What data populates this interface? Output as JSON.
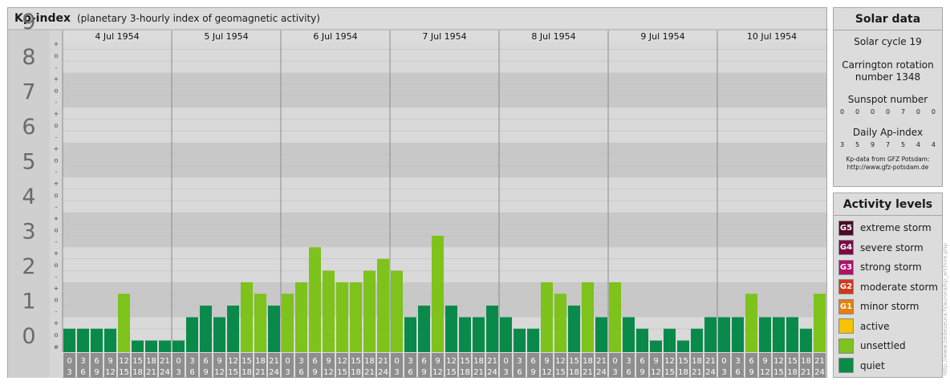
{
  "header": {
    "title": "Kp-index",
    "subtitle": "(planetary 3-hourly index of geomagnetic activity)"
  },
  "chart_data": {
    "type": "bar",
    "title": "Kp-index",
    "ylim": [
      0,
      9
    ],
    "y_ticks": [
      "0",
      "1",
      "2",
      "3",
      "4",
      "5",
      "6",
      "7",
      "8",
      "9"
    ],
    "y_minor_marks": [
      "+",
      "o",
      "-"
    ],
    "days": [
      "4 Jul 1954",
      "5 Jul 1954",
      "6 Jul 1954",
      "7 Jul 1954",
      "8 Jul 1954",
      "9 Jul 1954",
      "10 Jul 1954"
    ],
    "intervals": [
      [
        "0",
        "3"
      ],
      [
        "3",
        "6"
      ],
      [
        "6",
        "9"
      ],
      [
        "9",
        "12"
      ],
      [
        "12",
        "15"
      ],
      [
        "15",
        "18"
      ],
      [
        "18",
        "21"
      ],
      [
        "21",
        "24"
      ]
    ],
    "values": [
      0.67,
      0.67,
      0.67,
      0.67,
      1.67,
      0.33,
      0.33,
      0.33,
      0.33,
      1.0,
      1.33,
      1.0,
      1.33,
      2.0,
      1.67,
      1.33,
      1.67,
      2.0,
      3.0,
      2.33,
      2.0,
      2.0,
      2.33,
      2.67,
      2.33,
      1.0,
      1.33,
      3.33,
      1.33,
      1.0,
      1.0,
      1.33,
      1.0,
      0.67,
      0.67,
      2.0,
      1.67,
      1.33,
      2.0,
      1.0,
      2.0,
      1.0,
      0.67,
      0.33,
      0.67,
      0.33,
      0.67,
      1.0,
      1.0,
      1.0,
      1.67,
      1.0,
      1.0,
      1.0,
      0.67,
      1.67
    ],
    "colors": {
      "quiet": "#0a8a4a",
      "unsettled": "#7ec21c"
    },
    "grid": true
  },
  "solar": {
    "title": "Solar data",
    "cycle": "Solar cycle 19",
    "carrington_line1": "Carrington rotation",
    "carrington_line2": "number 1348",
    "sunspot_label": "Sunspot number",
    "sunspot_values": [
      "0",
      "0",
      "0",
      "0",
      "7",
      "0",
      "0"
    ],
    "ap_label": "Daily Ap-index",
    "ap_values": [
      "3",
      "5",
      "9",
      "7",
      "5",
      "4",
      "4"
    ],
    "credit_line1": "Kp-data from GFZ Potsdam:",
    "credit_line2": "http://www.gfz-potsdam.de"
  },
  "activity": {
    "title": "Activity levels",
    "items": [
      {
        "code": "G5",
        "label": "extreme storm",
        "color": "#4a0a2a"
      },
      {
        "code": "G4",
        "label": "severe storm",
        "color": "#7a0a44"
      },
      {
        "code": "G3",
        "label": "strong storm",
        "color": "#b01068"
      },
      {
        "code": "G2",
        "label": "moderate storm",
        "color": "#d0381c"
      },
      {
        "code": "G1",
        "label": "minor storm",
        "color": "#e67e10"
      },
      {
        "code": "",
        "label": "active",
        "color": "#f4c400"
      },
      {
        "code": "",
        "label": "unsettled",
        "color": "#7ec21c"
      },
      {
        "code": "",
        "label": "quiet",
        "color": "#0a8a4a"
      }
    ]
  },
  "watermark": "http://www.tiedeseura.fi/aurora/kp_archive.php"
}
